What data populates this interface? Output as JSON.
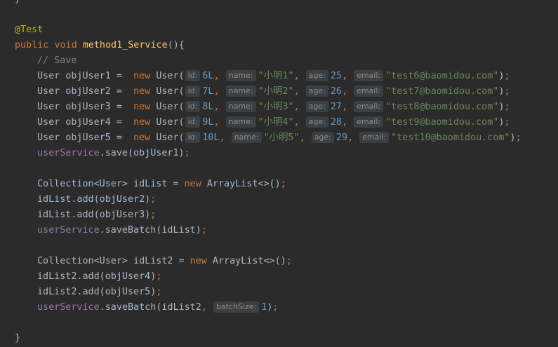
{
  "editor": {
    "lines": [
      {
        "indent": 0,
        "tokens": [
          {
            "t": "}",
            "c": "plain"
          }
        ]
      },
      {
        "indent": 0,
        "tokens": []
      },
      {
        "indent": 0,
        "tokens": [
          {
            "t": "@Test",
            "c": "ann"
          }
        ]
      },
      {
        "indent": 0,
        "tokens": [
          {
            "t": "public ",
            "c": "kw"
          },
          {
            "t": "void ",
            "c": "kw"
          },
          {
            "t": "method1_Service",
            "c": "method"
          },
          {
            "t": "(){",
            "c": "plain"
          }
        ]
      },
      {
        "indent": 1,
        "tokens": [
          {
            "t": "// Save",
            "c": "comment"
          }
        ]
      },
      {
        "indent": 1,
        "tokens": [
          {
            "t": "User objUser1 =  ",
            "c": "plain"
          },
          {
            "t": "new ",
            "c": "kw"
          },
          {
            "t": "User(",
            "c": "plain"
          },
          {
            "h": "id:"
          },
          {
            "t": "6L",
            "c": "num"
          },
          {
            "t": ", ",
            "c": "punct"
          },
          {
            "h": "name:"
          },
          {
            "t": "\"小明1\"",
            "c": "str"
          },
          {
            "t": ", ",
            "c": "punct"
          },
          {
            "h": "age:"
          },
          {
            "t": "25",
            "c": "num"
          },
          {
            "t": ", ",
            "c": "punct"
          },
          {
            "h": "email:"
          },
          {
            "t": "\"test6@baomidou.com\"",
            "c": "str"
          },
          {
            "t": ")",
            "c": "plain"
          },
          {
            "t": ";",
            "c": "punct"
          }
        ]
      },
      {
        "indent": 1,
        "tokens": [
          {
            "t": "User objUser2 =  ",
            "c": "plain"
          },
          {
            "t": "new ",
            "c": "kw"
          },
          {
            "t": "User(",
            "c": "plain"
          },
          {
            "h": "id:"
          },
          {
            "t": "7L",
            "c": "num"
          },
          {
            "t": ", ",
            "c": "punct"
          },
          {
            "h": "name:"
          },
          {
            "t": "\"小明2\"",
            "c": "str"
          },
          {
            "t": ", ",
            "c": "punct"
          },
          {
            "h": "age:"
          },
          {
            "t": "26",
            "c": "num"
          },
          {
            "t": ", ",
            "c": "punct"
          },
          {
            "h": "email:"
          },
          {
            "t": "\"test7@baomidou.com\"",
            "c": "str"
          },
          {
            "t": ")",
            "c": "plain"
          },
          {
            "t": ";",
            "c": "punct"
          }
        ]
      },
      {
        "indent": 1,
        "tokens": [
          {
            "t": "User objUser3 =  ",
            "c": "plain"
          },
          {
            "t": "new ",
            "c": "kw"
          },
          {
            "t": "User(",
            "c": "plain"
          },
          {
            "h": "id:"
          },
          {
            "t": "8L",
            "c": "num"
          },
          {
            "t": ", ",
            "c": "punct"
          },
          {
            "h": "name:"
          },
          {
            "t": "\"小明3\"",
            "c": "str"
          },
          {
            "t": ", ",
            "c": "punct"
          },
          {
            "h": "age:"
          },
          {
            "t": "27",
            "c": "num"
          },
          {
            "t": ", ",
            "c": "punct"
          },
          {
            "h": "email:"
          },
          {
            "t": "\"test8@baomidou.com\"",
            "c": "str"
          },
          {
            "t": ")",
            "c": "plain"
          },
          {
            "t": ";",
            "c": "punct"
          }
        ]
      },
      {
        "indent": 1,
        "tokens": [
          {
            "t": "User objUser4 =  ",
            "c": "plain"
          },
          {
            "t": "new ",
            "c": "kw"
          },
          {
            "t": "User(",
            "c": "plain"
          },
          {
            "h": "id:"
          },
          {
            "t": "9L",
            "c": "num"
          },
          {
            "t": ", ",
            "c": "punct"
          },
          {
            "h": "name:"
          },
          {
            "t": "\"小明4\"",
            "c": "str"
          },
          {
            "t": ", ",
            "c": "punct"
          },
          {
            "h": "age:"
          },
          {
            "t": "28",
            "c": "num"
          },
          {
            "t": ", ",
            "c": "punct"
          },
          {
            "h": "email:"
          },
          {
            "t": "\"test9@baomidou.com\"",
            "c": "str"
          },
          {
            "t": ")",
            "c": "plain"
          },
          {
            "t": ";",
            "c": "punct"
          }
        ]
      },
      {
        "indent": 1,
        "tokens": [
          {
            "t": "User objUser5 =  ",
            "c": "plain"
          },
          {
            "t": "new ",
            "c": "kw"
          },
          {
            "t": "User(",
            "c": "plain"
          },
          {
            "h": "id:"
          },
          {
            "t": "10L",
            "c": "num"
          },
          {
            "t": ", ",
            "c": "punct"
          },
          {
            "h": "name:"
          },
          {
            "t": "\"小明5\"",
            "c": "str"
          },
          {
            "t": ", ",
            "c": "punct"
          },
          {
            "h": "age:"
          },
          {
            "t": "29",
            "c": "num"
          },
          {
            "t": ", ",
            "c": "punct"
          },
          {
            "h": "email:"
          },
          {
            "t": "\"test10@baomidou.com\"",
            "c": "str"
          },
          {
            "t": ")",
            "c": "plain"
          },
          {
            "t": ";",
            "c": "punct"
          }
        ]
      },
      {
        "indent": 1,
        "tokens": [
          {
            "t": "userService",
            "c": "field"
          },
          {
            "t": ".save(objUser1)",
            "c": "plain"
          },
          {
            "t": ";",
            "c": "punct"
          }
        ]
      },
      {
        "indent": 0,
        "tokens": []
      },
      {
        "indent": 1,
        "tokens": [
          {
            "t": "Collection<User> idList = ",
            "c": "plain"
          },
          {
            "t": "new ",
            "c": "kw"
          },
          {
            "t": "ArrayList<>()",
            "c": "plain"
          },
          {
            "t": ";",
            "c": "punct"
          }
        ]
      },
      {
        "indent": 1,
        "tokens": [
          {
            "t": "idList.add(objUser2)",
            "c": "plain"
          },
          {
            "t": ";",
            "c": "punct"
          }
        ]
      },
      {
        "indent": 1,
        "tokens": [
          {
            "t": "idList.add(objUser3)",
            "c": "plain"
          },
          {
            "t": ";",
            "c": "punct"
          }
        ]
      },
      {
        "indent": 1,
        "tokens": [
          {
            "t": "userService",
            "c": "field"
          },
          {
            "t": ".saveBatch(idList)",
            "c": "plain"
          },
          {
            "t": ";",
            "c": "punct"
          }
        ]
      },
      {
        "indent": 0,
        "tokens": []
      },
      {
        "indent": 1,
        "tokens": [
          {
            "t": "Collection<User> idList2 = ",
            "c": "plain"
          },
          {
            "t": "new ",
            "c": "kw"
          },
          {
            "t": "ArrayList<>()",
            "c": "plain"
          },
          {
            "t": ";",
            "c": "punct"
          }
        ]
      },
      {
        "indent": 1,
        "tokens": [
          {
            "t": "idList2.add(objUser4)",
            "c": "plain"
          },
          {
            "t": ";",
            "c": "punct"
          }
        ]
      },
      {
        "indent": 1,
        "tokens": [
          {
            "t": "idList2.add(objUser5)",
            "c": "plain"
          },
          {
            "t": ";",
            "c": "punct"
          }
        ]
      },
      {
        "indent": 1,
        "tokens": [
          {
            "t": "userService",
            "c": "field"
          },
          {
            "t": ".saveBatch(idList2",
            "c": "plain"
          },
          {
            "t": ", ",
            "c": "punct"
          },
          {
            "h": "batchSize:"
          },
          {
            "t": "1",
            "c": "num"
          },
          {
            "t": ")",
            "c": "plain"
          },
          {
            "t": ";",
            "c": "punct"
          }
        ]
      },
      {
        "indent": 0,
        "tokens": []
      },
      {
        "indent": 0,
        "tokens": [
          {
            "t": "}",
            "c": "plain"
          }
        ]
      }
    ]
  },
  "colors": {
    "background": "#2b2b2b",
    "plain": "#a9b7c6",
    "annotation": "#bbb529",
    "keyword": "#cc7832",
    "method": "#ffc66d",
    "comment": "#808080",
    "number": "#6897bb",
    "string": "#6a8759",
    "field": "#9876aa",
    "hint_bg": "#3b3f42",
    "hint_text": "#8a8e92"
  }
}
